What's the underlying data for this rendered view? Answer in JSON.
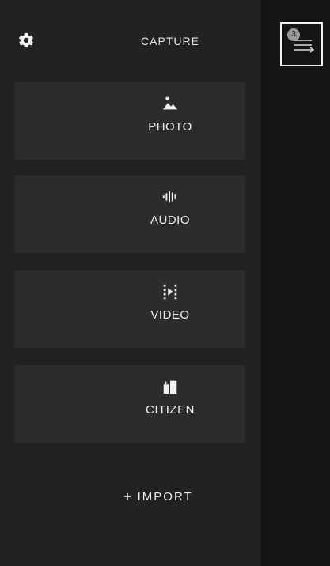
{
  "header": {
    "title": "CAPTURE",
    "settings_icon": "gear-icon",
    "queue_badge": "3",
    "queue_icon": "queue-list-icon"
  },
  "capture_options": [
    {
      "label": "PHOTO",
      "icon": "photo-icon"
    },
    {
      "label": "AUDIO",
      "icon": "audio-waveform-icon"
    },
    {
      "label": "VIDEO",
      "icon": "video-icon"
    },
    {
      "label": "CITIZEN",
      "icon": "citizen-icon"
    }
  ],
  "import": {
    "label": "IMPORT",
    "icon": "plus-icon"
  }
}
